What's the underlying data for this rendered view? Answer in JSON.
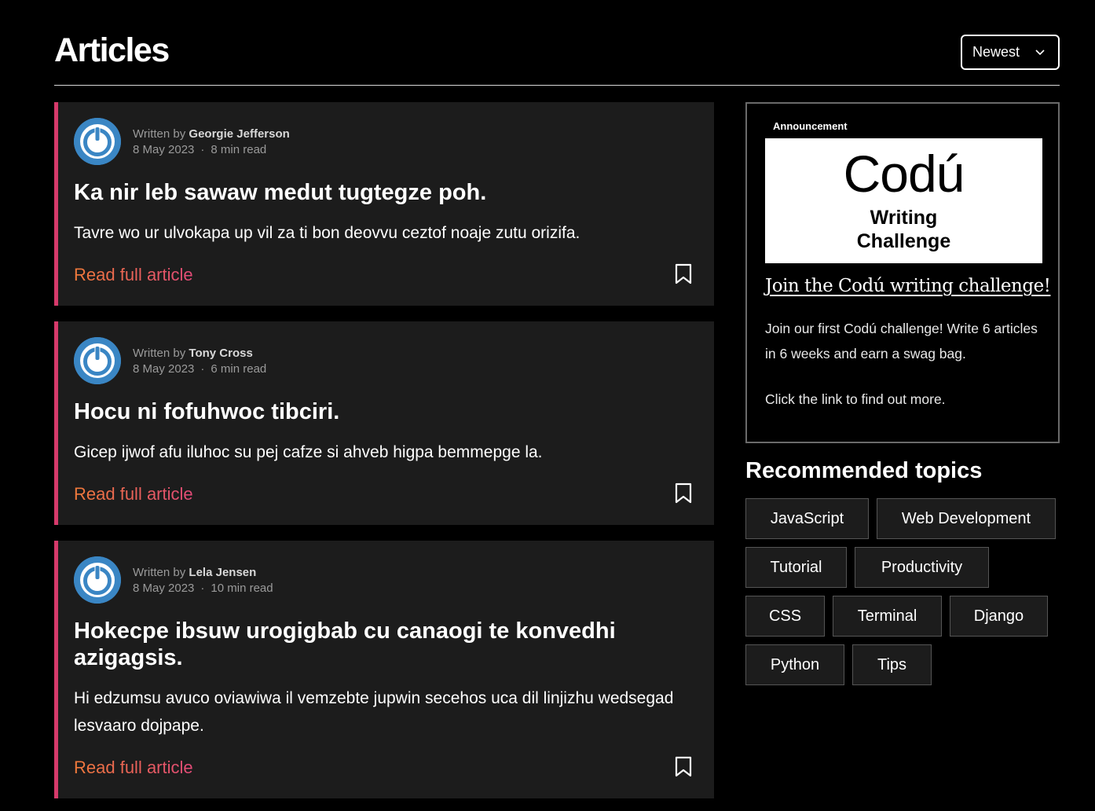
{
  "header": {
    "title": "Articles",
    "sort_selected": "Newest"
  },
  "articles": [
    {
      "written_by_label": "Written by",
      "author": "Georgie Jefferson",
      "date": "8 May 2023",
      "read_time": "8 min read",
      "title": "Ka nir leb sawaw medut tugtegze poh.",
      "excerpt": "Tavre wo ur ulvokapa up vil za ti bon deovvu ceztof noaje zutu orizifa.",
      "link_label": "Read full article"
    },
    {
      "written_by_label": "Written by",
      "author": "Tony Cross",
      "date": "8 May 2023",
      "read_time": "6 min read",
      "title": "Hocu ni fofuhwoc tibciri.",
      "excerpt": "Gicep ijwof afu iluhoc su pej cafze si ahveb higpa bemmepge la.",
      "link_label": "Read full article"
    },
    {
      "written_by_label": "Written by",
      "author": "Lela Jensen",
      "date": "8 May 2023",
      "read_time": "10 min read",
      "title": "Hokecpe ibsuw urogigbab cu canaogi te konvedhi azigagsis.",
      "excerpt": "Hi edzumsu avuco oviawiwa il vemzebte jupwin secehos uca dil linjizhu wedsegad lesvaaro dojpape.",
      "link_label": "Read full article"
    }
  ],
  "announcement": {
    "tag": "Announcement",
    "logo_text": "Codú",
    "banner_subtitle_line1": "Writing",
    "banner_subtitle_line2": "Challenge",
    "link": "Join the Codú writing challenge!",
    "body": "Join our first Codú challenge! Write 6 articles in 6 weeks and earn a swag bag.",
    "cta": "Click the link to find out more."
  },
  "topics": {
    "title": "Recommended topics",
    "items": [
      "JavaScript",
      "Web Development",
      "Tutorial",
      "Productivity",
      "CSS",
      "Terminal",
      "Django",
      "Python",
      "Tips"
    ]
  },
  "colors": {
    "accent_border": "#d63a6b",
    "link_gradient_start": "#f07a3a",
    "link_gradient_end": "#e24a78",
    "avatar_blue": "#3a86c4",
    "card_bg": "#1c1c1c"
  }
}
